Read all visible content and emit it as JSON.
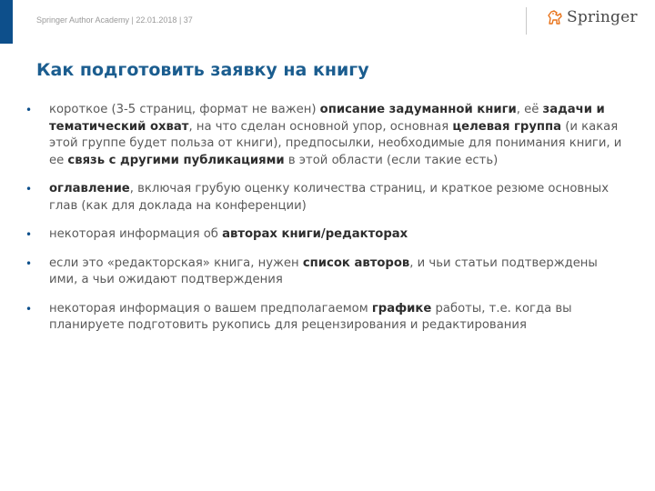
{
  "header": {
    "text": "Springer Author Academy | 22.01.2018 | 37",
    "logo_text": "Springer",
    "logo_icon": "springer-horse-icon",
    "accent_color": "#0d4f8b"
  },
  "slide": {
    "title": "Как подготовить заявку на книгу",
    "bullets": [
      {
        "segments": [
          {
            "text": "короткое (3-5 страниц, формат не важен) ",
            "bold": false
          },
          {
            "text": "описание задуманной книги",
            "bold": true
          },
          {
            "text": ", её ",
            "bold": false
          },
          {
            "text": "задачи и тематический охват",
            "bold": true
          },
          {
            "text": ", на что сделан основной упор, основная ",
            "bold": false
          },
          {
            "text": "целевая группа",
            "bold": true
          },
          {
            "text": " (и какая этой группе будет польза от книги), предпосылки, необходимые для понимания книги, и ее ",
            "bold": false
          },
          {
            "text": "связь с другими публикациями",
            "bold": true
          },
          {
            "text": " в этой области (если такие есть)",
            "bold": false
          }
        ]
      },
      {
        "segments": [
          {
            "text": "оглавление",
            "bold": true
          },
          {
            "text": ", включая грубую оценку количества страниц, и краткое резюме основных глав (как для доклада на конференции)",
            "bold": false
          }
        ]
      },
      {
        "segments": [
          {
            "text": "некоторая информация об ",
            "bold": false
          },
          {
            "text": "авторах книги/редакторах",
            "bold": true
          }
        ]
      },
      {
        "segments": [
          {
            "text": "если это «редакторская» книга, нужен ",
            "bold": false
          },
          {
            "text": "список авторов",
            "bold": true
          },
          {
            "text": ", и чьи статьи подтверждены ими, а чьи ожидают подтверждения",
            "bold": false
          }
        ]
      },
      {
        "segments": [
          {
            "text": "некоторая информация о вашем предполагаемом ",
            "bold": false
          },
          {
            "text": "графике",
            "bold": true
          },
          {
            "text": " работы, т.е. когда вы планируете подготовить рукопись для рецензирования и редактирования",
            "bold": false
          }
        ]
      }
    ]
  }
}
